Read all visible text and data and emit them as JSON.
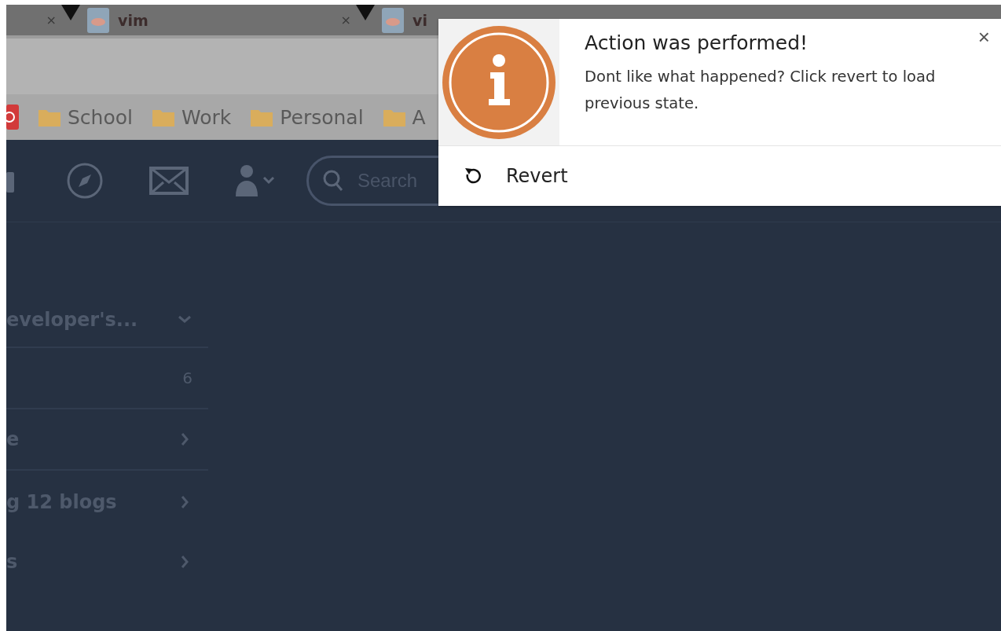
{
  "tabs": [
    {
      "close": "×"
    },
    {
      "label": "vim",
      "close": "×"
    },
    {
      "label": "vi"
    }
  ],
  "bookmarks": [
    {
      "kind": "app"
    },
    {
      "kind": "folder",
      "label": "School"
    },
    {
      "kind": "folder",
      "label": "Work"
    },
    {
      "kind": "folder",
      "label": "Personal"
    },
    {
      "kind": "folder",
      "label": "A"
    }
  ],
  "search": {
    "placeholder": "Search"
  },
  "sidebar": {
    "items": [
      {
        "kind": "dropdown",
        "label": "eveloper's..."
      },
      {
        "kind": "count",
        "count": "6"
      },
      {
        "kind": "link",
        "label": "e"
      },
      {
        "kind": "link",
        "label": "g 12 blogs"
      },
      {
        "kind": "link",
        "label": "s"
      }
    ]
  },
  "notification": {
    "title": "Action was performed!",
    "message": "Dont like what happened? Click revert to load previous state.",
    "close": "×",
    "action": "Revert"
  }
}
